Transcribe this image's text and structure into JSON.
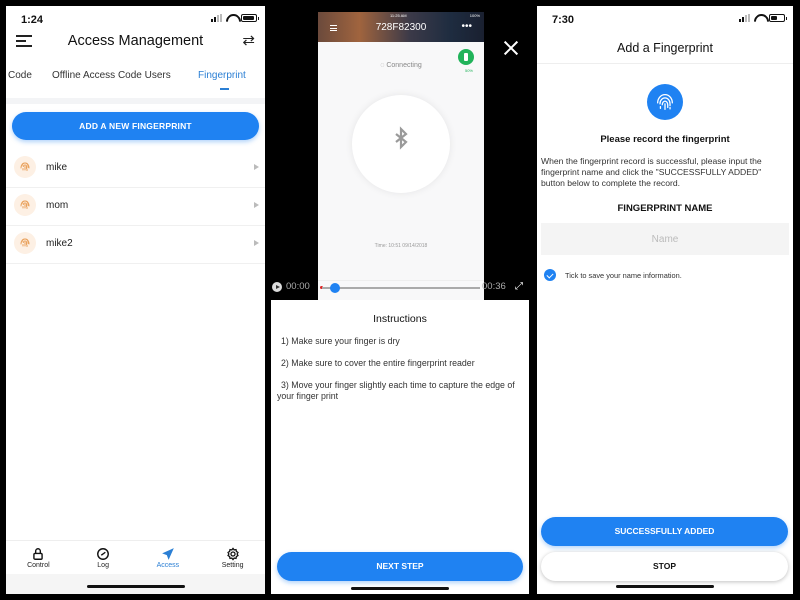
{
  "panel_left": {
    "status_bar": {
      "time": "1:24"
    },
    "header": {
      "title": "Access Management",
      "menu_icon": "hamburger-menu-icon",
      "swap_icon": "swap-arrows-icon"
    },
    "tabs": [
      {
        "label": "Code",
        "active": false
      },
      {
        "label": "Offline Access Code Users",
        "active": false
      },
      {
        "label": "Fingerprint",
        "active": true
      }
    ],
    "add_button_label": "ADD A NEW FINGERPRINT",
    "fingerprints": [
      {
        "name": "mike"
      },
      {
        "name": "mom"
      },
      {
        "name": "mike2"
      }
    ],
    "bottom_nav": [
      {
        "label": "Control",
        "icon": "lock-icon",
        "active": false
      },
      {
        "label": "Log",
        "icon": "clock-icon",
        "active": false
      },
      {
        "label": "Access",
        "icon": "paper-plane-icon",
        "active": true
      },
      {
        "label": "Setting",
        "icon": "gear-icon",
        "active": false
      }
    ]
  },
  "panel_middle": {
    "video": {
      "phone_status_time": "11:25 AM",
      "phone_status_battery": "100%",
      "device_title": "728F82300",
      "connecting_text": "Connecting",
      "battery_percent": "50%",
      "time_label": "Time:",
      "time_value": "10:51 09/14/2018",
      "current_time": "00:00",
      "duration": "00:36",
      "progress_fraction": 0.08
    },
    "instructions": {
      "title": "Instructions",
      "steps": [
        "1) Make sure your finger is dry",
        "2) Make sure to cover the entire fingerprint reader",
        "3) Move your finger slightly each time to capture the edge of your finger print"
      ]
    },
    "next_button_label": "NEXT STEP"
  },
  "panel_right": {
    "status_bar": {
      "time": "7:30"
    },
    "title": "Add a Fingerprint",
    "prompt": "Please record the fingerprint",
    "description": "When the fingerprint record is successful, please input the fingerprint name and click the \"SUCCESSFULLY ADDED\" button below to complete the record.",
    "name_label": "FINGERPRINT NAME",
    "name_input": {
      "value": "",
      "placeholder": "Name"
    },
    "save_checkbox": {
      "checked": true,
      "label": "Tick to save your name information."
    },
    "success_button_label": "SUCCESSFULLY ADDED",
    "stop_button_label": "STOP"
  },
  "colors": {
    "accent": "#1f82f2",
    "tab_active": "#2b7fd4",
    "fingerprint_icon": "#e9a15c",
    "battery_badge": "#21b35a"
  }
}
